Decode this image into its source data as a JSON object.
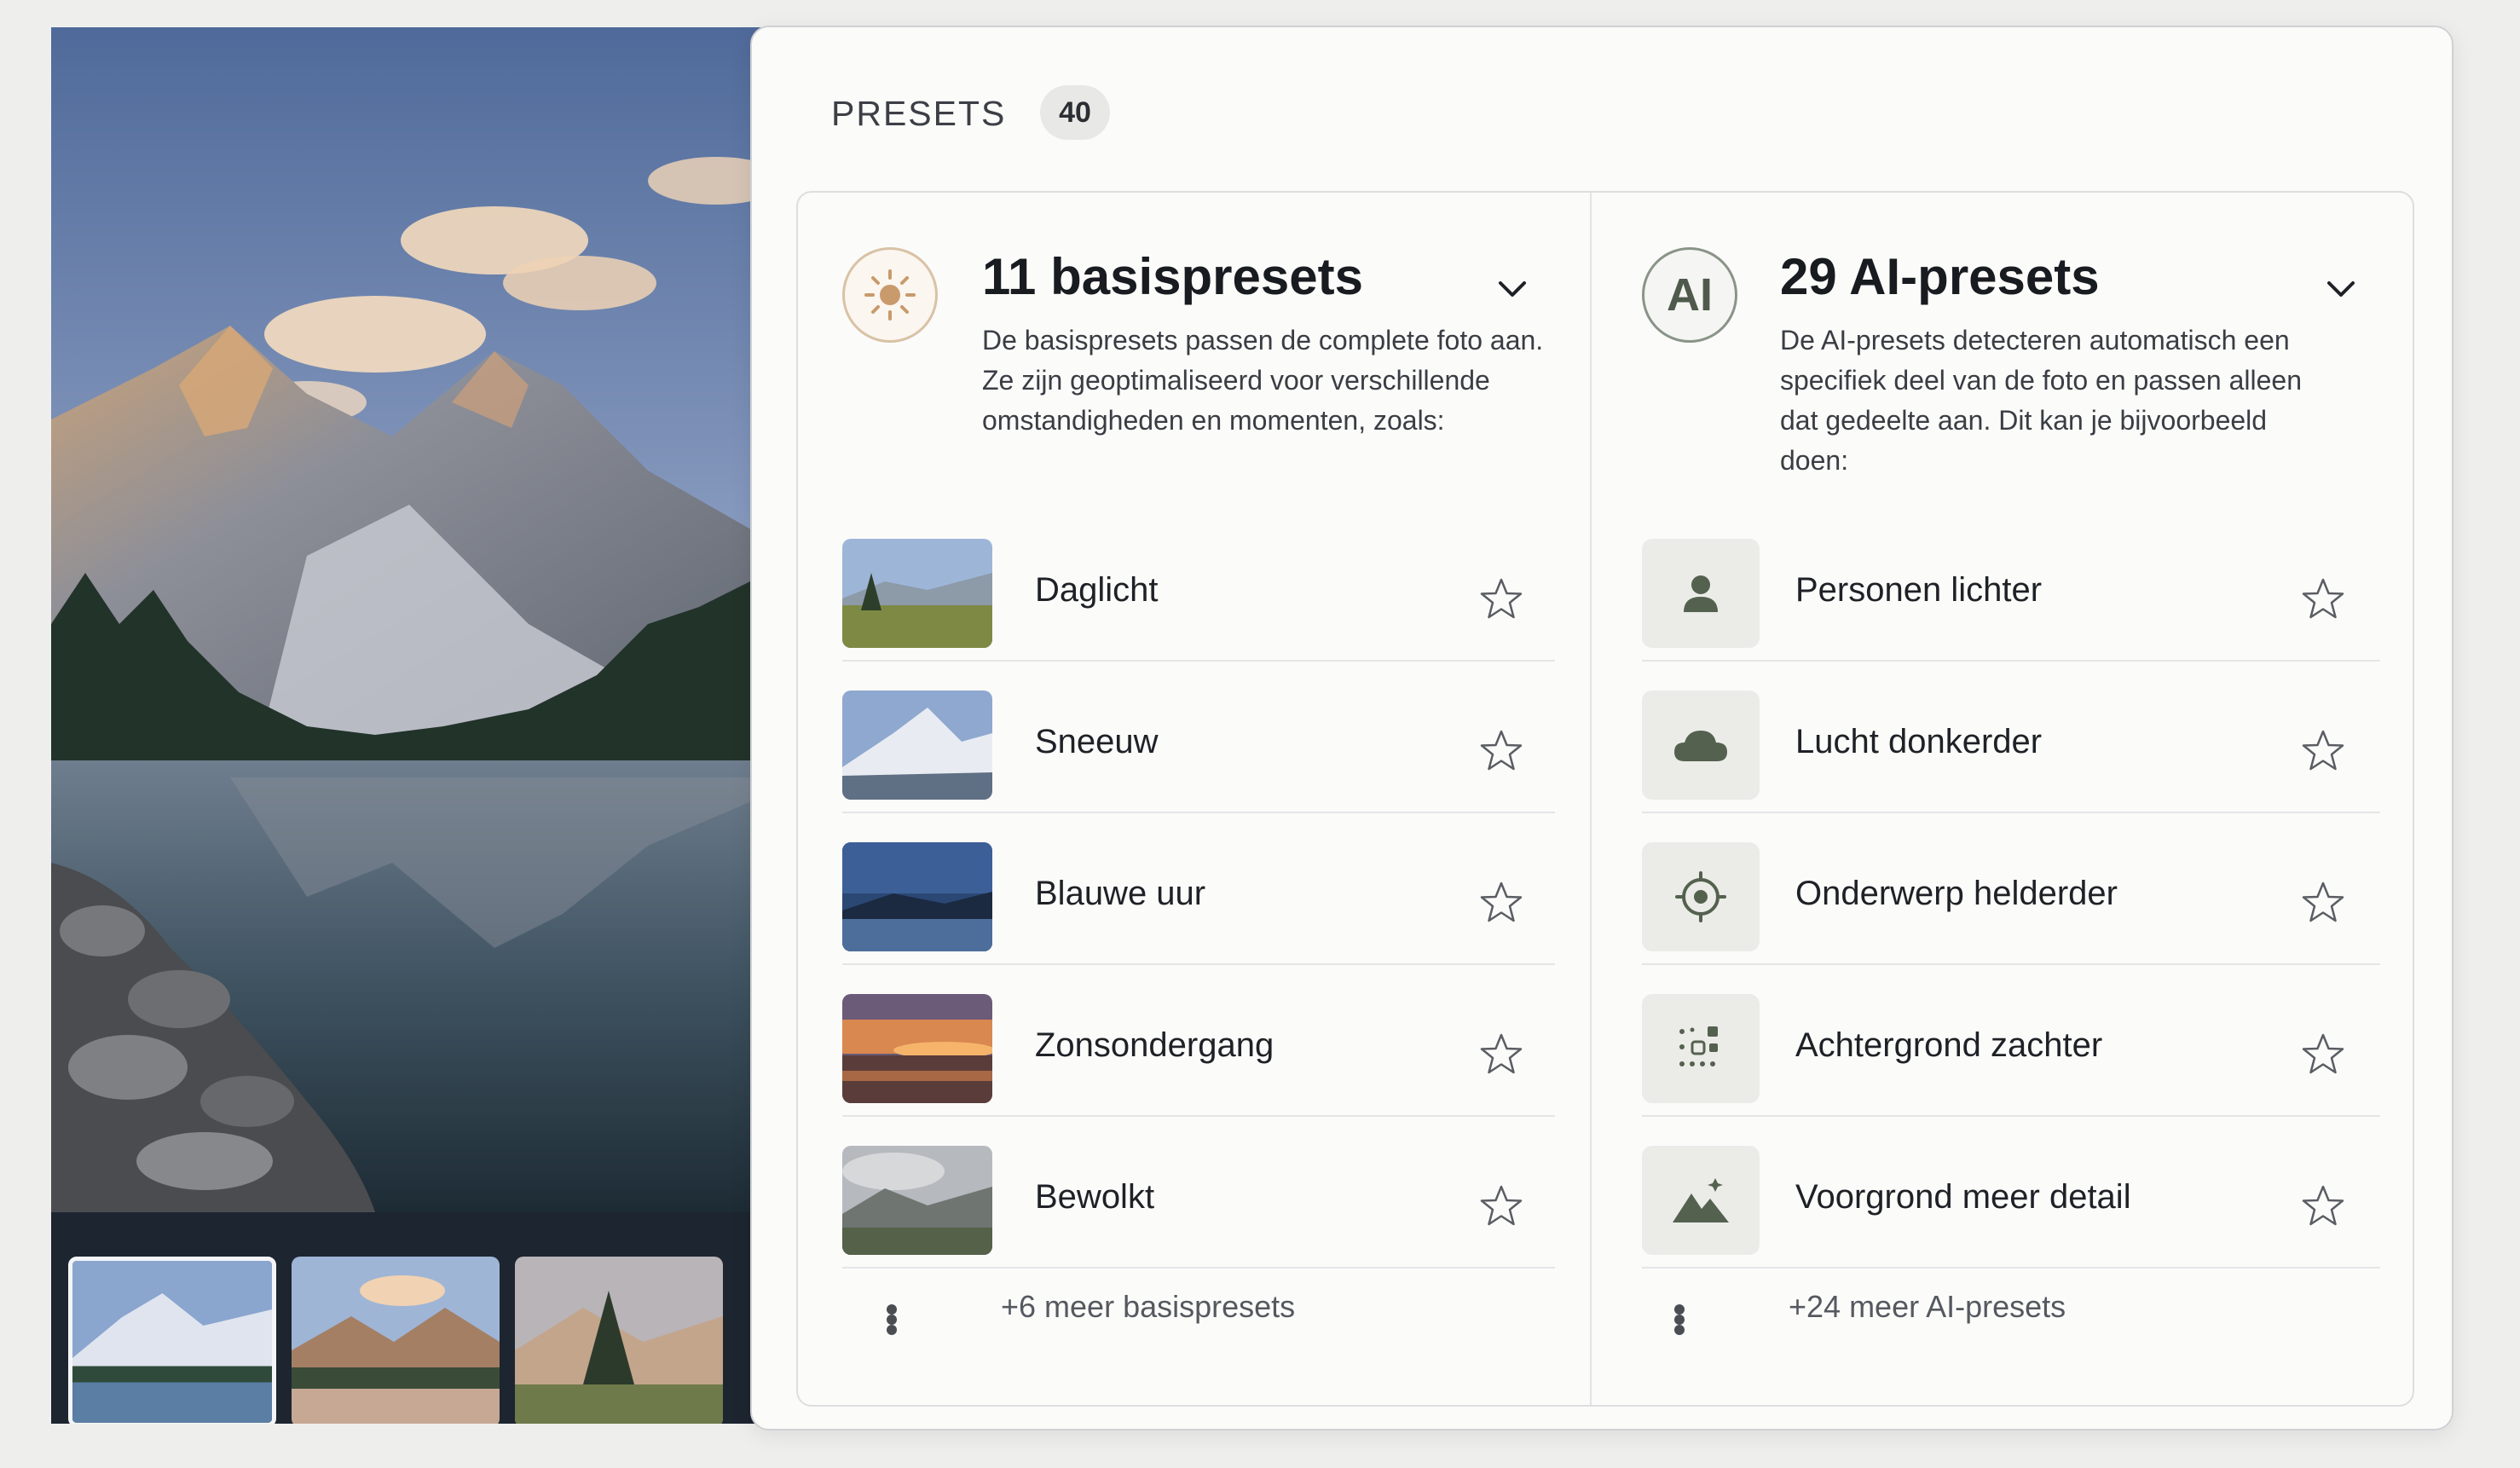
{
  "presets_header": {
    "title": "PRESETS",
    "count": "40"
  },
  "basis": {
    "heading": "11 basispresets",
    "description": "De basispresets passen de complete foto aan. Ze zijn geoptimaliseerd voor verschillende omstandigheden en momenten, zoals:",
    "icon": "sun-icon",
    "items": [
      {
        "label": "Daglicht"
      },
      {
        "label": "Sneeuw"
      },
      {
        "label": "Blauwe uur"
      },
      {
        "label": "Zonsondergang"
      },
      {
        "label": "Bewolkt"
      }
    ],
    "more_label": "+6 meer basispresets"
  },
  "ai": {
    "heading": "29 AI-presets",
    "icon_text": "AI",
    "description": "De AI-presets detecteren automatisch een specifiek deel van de foto en passen alleen dat gedeelte aan. Dit kan je bijvoorbeeld doen:",
    "items": [
      {
        "label": "Personen lichter",
        "icon": "person-icon"
      },
      {
        "label": "Lucht donkerder",
        "icon": "cloud-icon"
      },
      {
        "label": "Onderwerp helderder",
        "icon": "target-icon"
      },
      {
        "label": "Achtergrond zachter",
        "icon": "background-dots-icon"
      },
      {
        "label": "Voorgrond meer detail",
        "icon": "mountains-sparkle-icon"
      }
    ],
    "more_label": "+24 meer AI-presets"
  },
  "colors": {
    "accent_sun": "#c9a27a",
    "ai_icon": "#55614f",
    "panel_bg": "#fbfbfa"
  }
}
